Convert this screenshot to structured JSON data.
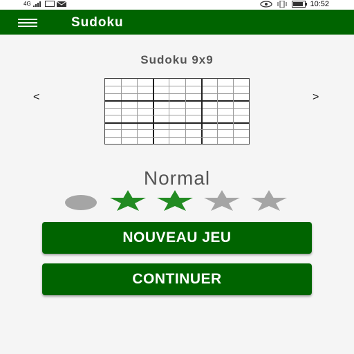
{
  "status_bar": {
    "left_text": "4G",
    "time": "10:52"
  },
  "app_bar": {
    "title": "Sudoku",
    "menu_icon": "hamburger-menu-icon"
  },
  "puzzle": {
    "title": "Sudoku 9x9",
    "prev_label": "<",
    "next_label": ">",
    "grid_size": 9
  },
  "difficulty": {
    "label": "Normal",
    "level": 2,
    "max_level": 4,
    "colors": {
      "active": "#228B22",
      "inactive": "#a5a5a5"
    }
  },
  "buttons": {
    "new_game": "NOUVEAU JEU",
    "continue": "CONTINUER"
  },
  "colors": {
    "primary": "#006400",
    "background": "#f5f5f5"
  }
}
